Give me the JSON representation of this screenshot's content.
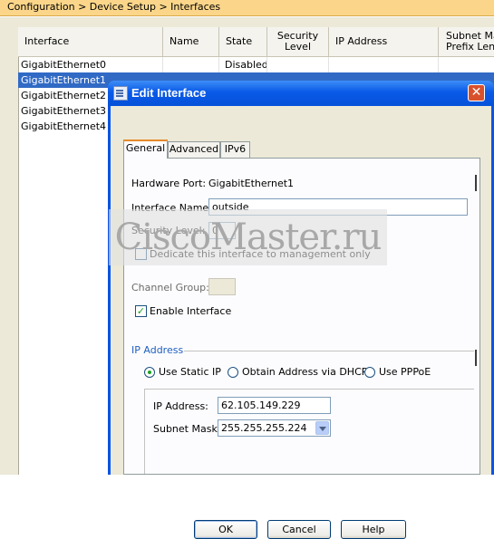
{
  "breadcrumb": "Configuration > Device Setup > Interfaces",
  "table": {
    "columns": [
      "Interface",
      "Name",
      "State",
      "Security Level",
      "IP Address",
      "Subnet Mask Prefix Length"
    ],
    "col_lines": {
      "security": [
        "Security",
        "Level"
      ],
      "subnet": [
        "Subnet Mas",
        "Prefix Leng"
      ]
    },
    "rows": [
      {
        "interface": "GigabitEthernet0",
        "state": "Disabled"
      },
      {
        "interface": "GigabitEthernet1",
        "state": ""
      },
      {
        "interface": "GigabitEthernet2",
        "state": ""
      },
      {
        "interface": "GigabitEthernet3",
        "state": ""
      },
      {
        "interface": "GigabitEthernet4",
        "state": ""
      }
    ],
    "selected_row": 1
  },
  "dialog": {
    "title": "Edit Interface",
    "tabs": [
      "General",
      "Advanced",
      "IPv6"
    ],
    "active_tab": "General",
    "hardware_port_label": "Hardware Port:",
    "hardware_port_value": "GigabitEthernet1",
    "interface_name_label": "Interface Name:",
    "interface_name_value": "outside",
    "security_level_label": "Security Level:",
    "security_level_value": "0",
    "dedicate_label": "Dedicate this interface to management only",
    "dedicate_checked": false,
    "channel_group_label": "Channel Group:",
    "channel_group_value": "",
    "enable_label": "Enable Interface",
    "enable_checked": true,
    "ip_section_title": "IP Address",
    "ip_options": [
      "Use Static IP",
      "Obtain Address via DHCP",
      "Use PPPoE"
    ],
    "ip_selected": "Use Static IP",
    "ip_address_label": "IP Address:",
    "ip_address_value": "62.105.149.229",
    "subnet_mask_label": "Subnet Mask:",
    "subnet_mask_value": "255.255.255.224",
    "buttons": {
      "ok": "OK",
      "cancel": "Cancel",
      "help": "Help"
    }
  },
  "watermark": "CiscoMaster.ru",
  "colors": {
    "breadcrumb_bg": "#fbd68a",
    "selection": "#316ac5",
    "titlebar": "#0a5ae8",
    "section_title": "#1f5fbf",
    "check_green": "#21a121"
  }
}
